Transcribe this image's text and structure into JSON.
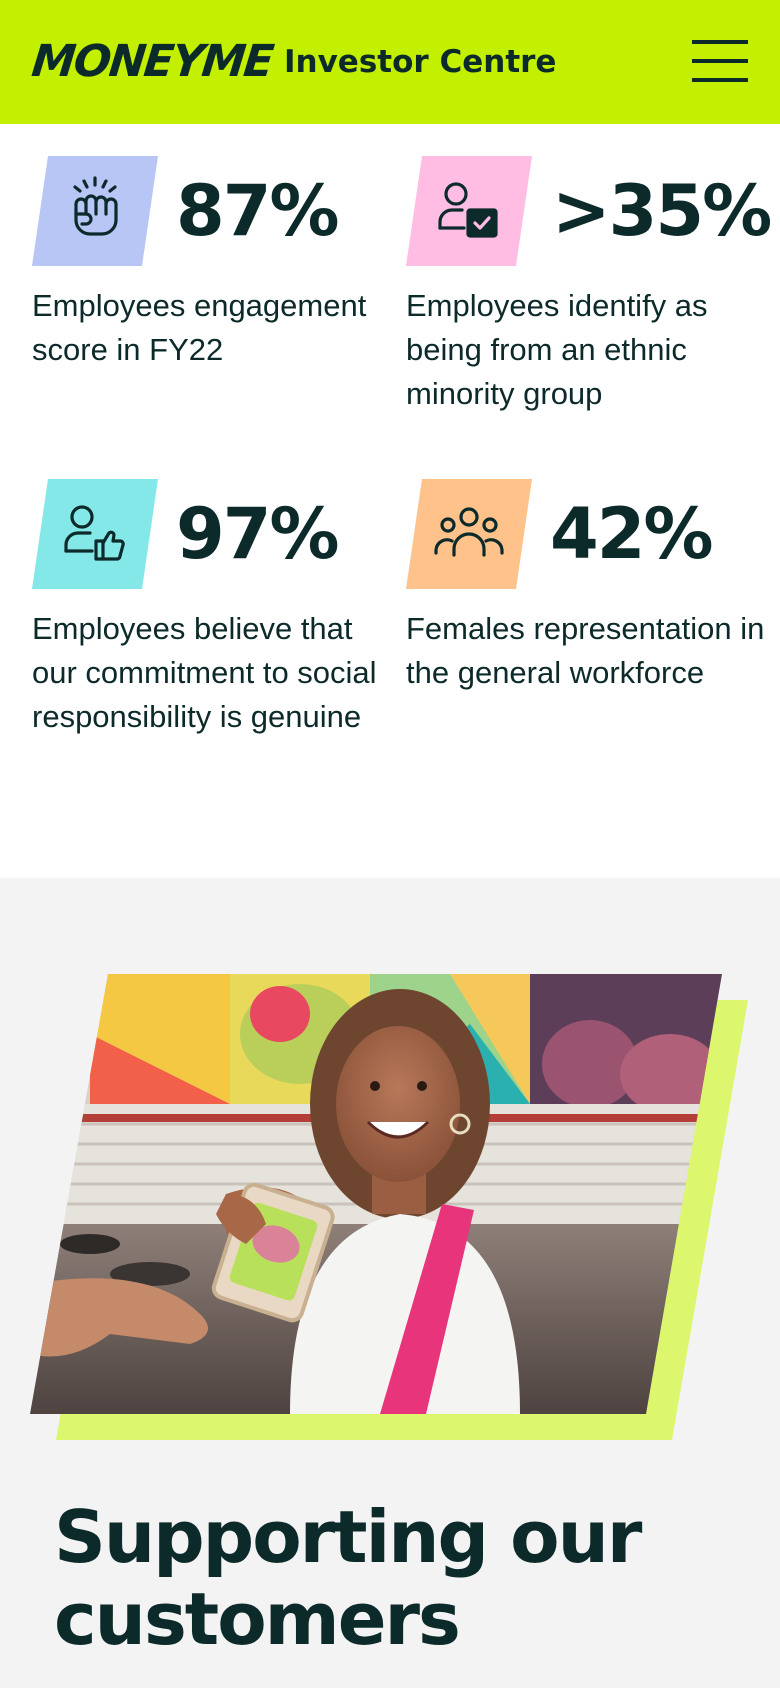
{
  "header": {
    "brand": "MONEYME",
    "title": "Investor Centre",
    "menu_icon": "hamburger-menu-icon"
  },
  "stats": [
    {
      "value": "87%",
      "description": "Employees engagement score in FY22",
      "icon": "fist-bump-icon",
      "icon_color": "#b8c6f5"
    },
    {
      "value": ">35%",
      "description": "Employees identify as being from an ethnic minority group",
      "icon": "user-check-icon",
      "icon_color": "#ffbde3"
    },
    {
      "value": "97%",
      "description": "Employees believe that our commitment to social responsibility is genuine",
      "icon": "user-thumbs-up-icon",
      "icon_color": "#84e8e8"
    },
    {
      "value": "42%",
      "description": "Females representation in the general workforce",
      "icon": "group-users-icon",
      "icon_color": "#ffc28a"
    }
  ],
  "feature": {
    "heading": "Supporting our customers",
    "photo_accent_color": "#dcf76e"
  },
  "colors": {
    "brand_lime": "#c2f000",
    "text_dark": "#0d2a2b",
    "section_bg": "#f3f3f3"
  }
}
